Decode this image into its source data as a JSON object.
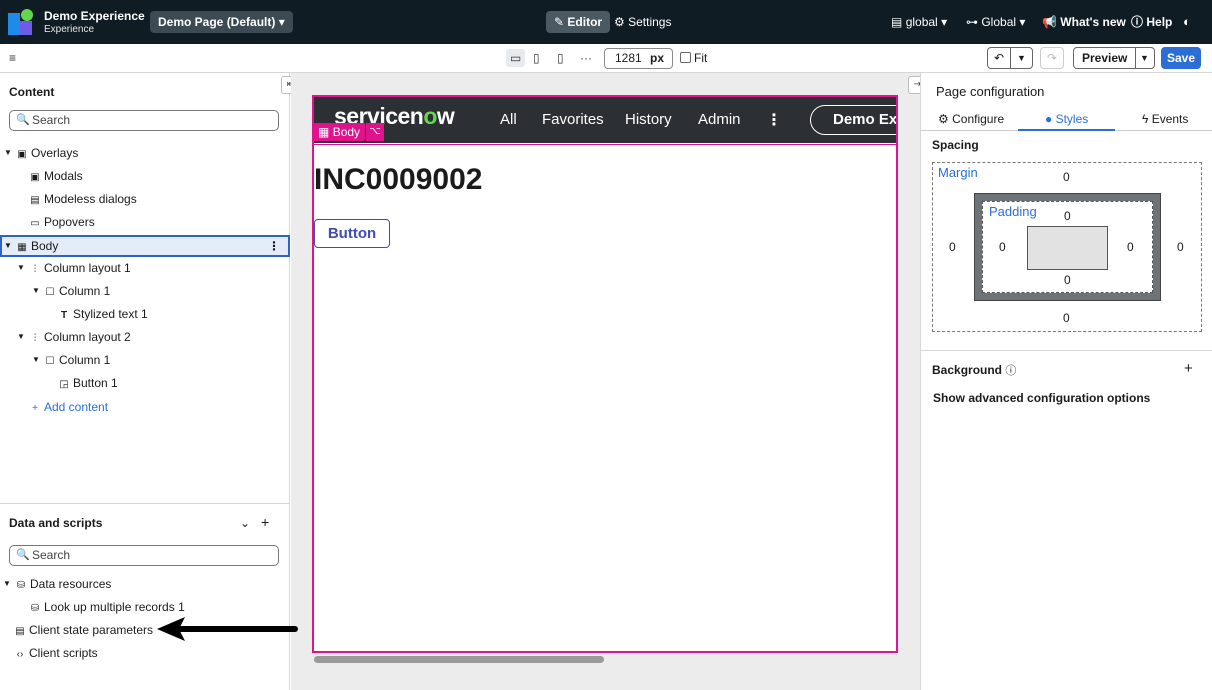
{
  "header": {
    "app_name": "Demo Experience",
    "app_subtitle": "Experience",
    "page_select": "Demo Page (Default)",
    "editor_label": "Editor",
    "settings_label": "Settings",
    "scope": "global",
    "app_scope": "Global",
    "whats_new": "What's new",
    "help": "Help"
  },
  "toolbar": {
    "width_value": "1281",
    "width_unit": "px",
    "fit_label": "Fit",
    "preview_label": "Preview",
    "save_label": "Save"
  },
  "content_panel": {
    "title": "Content",
    "search_placeholder": "Search",
    "tree": {
      "overlays": "Overlays",
      "modals": "Modals",
      "modeless": "Modeless dialogs",
      "popovers": "Popovers",
      "body": "Body",
      "col_layout_1": "Column layout 1",
      "col_1a": "Column 1",
      "stylized_text": "Stylized text 1",
      "col_layout_2": "Column layout 2",
      "col_1b": "Column 1",
      "button_1": "Button 1",
      "add_content": "Add content"
    }
  },
  "data_panel": {
    "title": "Data and scripts",
    "search_placeholder": "Search",
    "data_resources": "Data resources",
    "lookup": "Look up multiple records 1",
    "client_state": "Client state parameters",
    "client_scripts": "Client scripts"
  },
  "canvas": {
    "nav_links": [
      "All",
      "Favorites",
      "History",
      "Admin"
    ],
    "pill": "Demo Exp",
    "body_tag": "Body",
    "incident": "INC0009002",
    "button": "Button"
  },
  "config_panel": {
    "title": "Page configuration",
    "tabs": [
      "Configure",
      "Styles",
      "Events"
    ],
    "spacing": "Spacing",
    "margin_label": "Margin",
    "padding_label": "Padding",
    "margin": {
      "top": "0",
      "right": "0",
      "bottom": "0",
      "left": "0"
    },
    "padding": {
      "top": "0",
      "right": "0",
      "bottom": "0",
      "left": "0"
    },
    "background": "Background",
    "advanced": "Show advanced configuration options"
  },
  "colors": {
    "header_bg": "#0f1c24",
    "accent": "#2b6fd6",
    "selection": "#e0128c"
  }
}
